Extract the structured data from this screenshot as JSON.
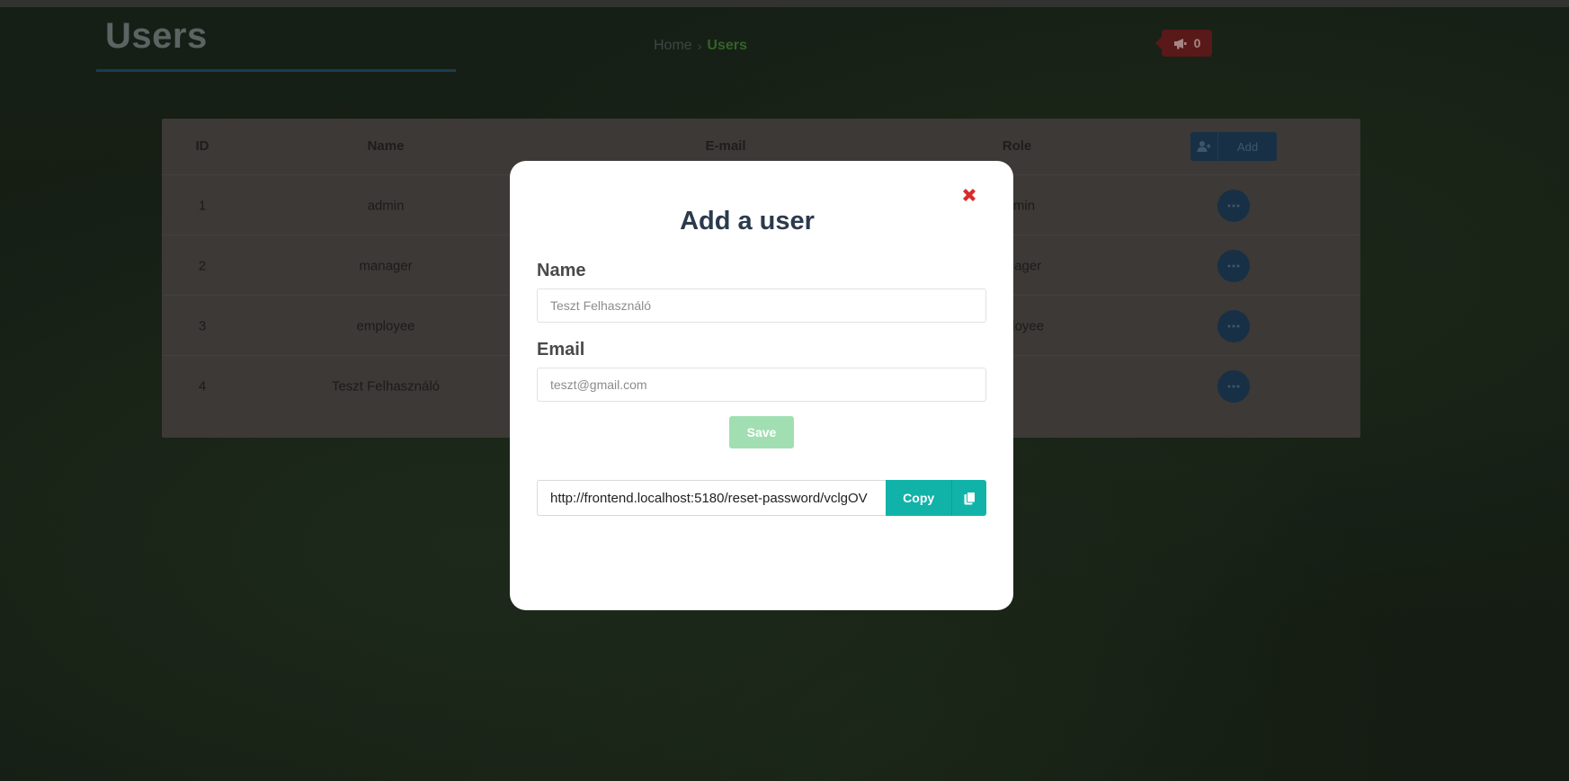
{
  "header": {
    "title": "Users",
    "breadcrumb": {
      "home": "Home",
      "separator": "›",
      "current": "Users"
    },
    "notifications": {
      "count": "0",
      "icon": "megaphone-icon"
    }
  },
  "table": {
    "columns": [
      "ID",
      "Name",
      "E-mail",
      "Role"
    ],
    "add_button_label": "Add",
    "add_button_icon": "user-plus-icon",
    "rows": [
      {
        "id": "1",
        "name": "admin",
        "role_visible": "min"
      },
      {
        "id": "2",
        "name": "manager",
        "role_visible": "nager"
      },
      {
        "id": "3",
        "name": "employee",
        "role_visible": "ployee"
      },
      {
        "id": "4",
        "name": "Teszt Felhasználó",
        "role_visible": ""
      }
    ],
    "row_action_icon": "ellipsis-icon"
  },
  "modal": {
    "title": "Add a user",
    "close_icon": "close-icon",
    "name_label": "Name",
    "name_placeholder": "Teszt Felhasználó",
    "email_label": "Email",
    "email_placeholder": "teszt@gmail.com",
    "save_label": "Save",
    "reset_link_value": "http://frontend.localhost:5180/reset-password/vclgOV",
    "copy_label": "Copy",
    "copy_icon": "clipboard-icon"
  },
  "colors": {
    "modal_title": "#2b3a4d",
    "save_button": "#a1dfb3",
    "copy_button": "#11b3a8",
    "close_icon": "#d92b2b",
    "breadcrumb_current": "#3d7a30",
    "notification_badge": "#6e1f1f"
  }
}
